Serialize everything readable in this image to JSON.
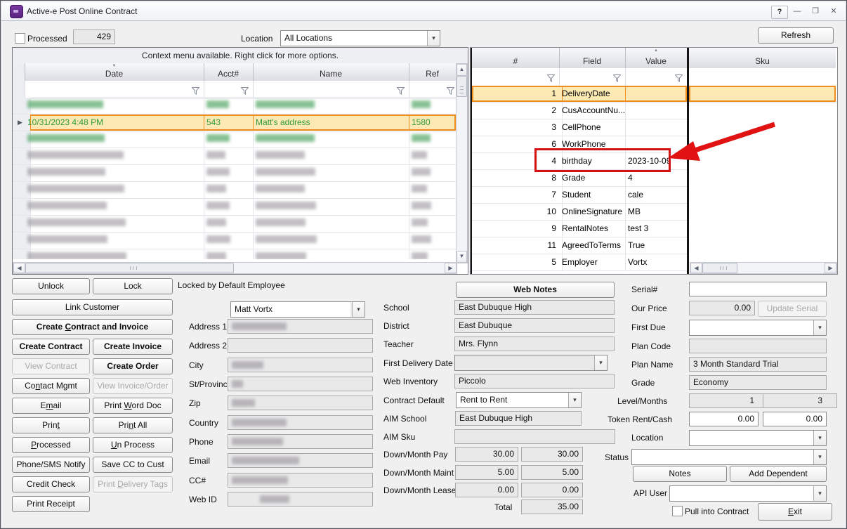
{
  "window": {
    "title": "Active-e Post Online Contract",
    "help_label": "?"
  },
  "toolbar": {
    "processed_label": "Processed",
    "processed_count": "429",
    "location_label": "Location",
    "location_value": "All Locations",
    "refresh_label": "Refresh"
  },
  "left_grid": {
    "caption": "Context menu available. Right click for more options.",
    "columns": [
      "Date",
      "Acct#",
      "Name",
      "Ref"
    ],
    "sort_column": "Date",
    "rows": [
      {
        "redacted": true,
        "tone": "green"
      },
      {
        "selected": true,
        "cells": [
          "10/31/2023 4:48 PM",
          "543",
          "Matt's address",
          "1580"
        ]
      },
      {
        "redacted": true,
        "tone": "green"
      },
      {
        "redacted": true,
        "tone": "gray"
      },
      {
        "redacted": true,
        "tone": "gray"
      },
      {
        "redacted": true,
        "tone": "gray"
      },
      {
        "redacted": true,
        "tone": "gray"
      },
      {
        "redacted": true,
        "tone": "gray"
      },
      {
        "redacted": true,
        "tone": "gray"
      },
      {
        "redacted": true,
        "tone": "gray"
      }
    ]
  },
  "right_grid": {
    "columns": [
      "#",
      "Field",
      "Value",
      "Sku"
    ],
    "sort_column": "Value",
    "rows": [
      {
        "num": "1",
        "field": "DeliveryDate",
        "value": "",
        "selected": true
      },
      {
        "num": "2",
        "field": "CusAccountNu...",
        "value": ""
      },
      {
        "num": "3",
        "field": "CellPhone",
        "value": ""
      },
      {
        "num": "6",
        "field": "WorkPhone",
        "value": ""
      },
      {
        "num": "4",
        "field": "birthday",
        "value": "2023-10-09",
        "annotated": true
      },
      {
        "num": "8",
        "field": "Grade",
        "value": "4"
      },
      {
        "num": "7",
        "field": "Student",
        "value": "cale"
      },
      {
        "num": "10",
        "field": "OnlineSignature",
        "value": "MB"
      },
      {
        "num": "9",
        "field": "RentalNotes",
        "value": "test 3"
      },
      {
        "num": "11",
        "field": "AgreedToTerms",
        "value": "True"
      },
      {
        "num": "5",
        "field": "Employer",
        "value": "Vortx"
      }
    ]
  },
  "annotation": {
    "target": "birthday row",
    "color": "#d51010"
  },
  "actions": {
    "unlock": {
      "label": "Unlock"
    },
    "lock": {
      "label": "Lock"
    },
    "locked_by": "Locked by Default Employee",
    "link_customer": {
      "label": "Link Customer"
    },
    "create_contract_invoice": {
      "label": "Create Contract and Invoice",
      "accel": 7
    },
    "create_contract": {
      "label": "Create Contract"
    },
    "create_invoice": {
      "label": "Create Invoice"
    },
    "view_contract": {
      "label": "View Contract"
    },
    "create_order": {
      "label": "Create Order"
    },
    "contact_mgmt": {
      "label": "Contact Mgmt",
      "accel": 2
    },
    "view_invoice_order": {
      "label": "View Invoice/Order"
    },
    "email": {
      "label": "Email",
      "accel": 1
    },
    "print_word_doc": {
      "label": "Print Word Doc",
      "accel": 6
    },
    "print": {
      "label": "Print",
      "accel": 4
    },
    "print_all": {
      "label": "Print All",
      "accel": 3
    },
    "processed": {
      "label": "Processed",
      "accel": 0
    },
    "un_process": {
      "label": "Un Process",
      "accel": 0
    },
    "phone_sms": {
      "label": "Phone/SMS Notify"
    },
    "save_cc": {
      "label": "Save CC to Cust"
    },
    "credit_check": {
      "label": "Credit Check"
    },
    "print_delivery_tags": {
      "label": "Print Delivery Tags",
      "accel": 6
    },
    "print_receipt": {
      "label": "Print Receipt"
    }
  },
  "customer": {
    "name_value": "Matt Vortx",
    "labels": {
      "address1": "Address 1",
      "address2": "Address 2",
      "city": "City",
      "state": "St/Province",
      "zip": "Zip",
      "country": "Country",
      "phone": "Phone",
      "email": "Email",
      "cc": "CC#",
      "webid": "Web ID"
    }
  },
  "details": {
    "web_notes_label": "Web Notes",
    "school_label": "School",
    "school": "East Dubuque High",
    "district_label": "District",
    "district": "East Dubuque",
    "teacher_label": "Teacher",
    "teacher": "Mrs. Flynn",
    "first_delivery_label": "First Delivery Date",
    "first_delivery": "",
    "web_inventory_label": "Web Inventory",
    "web_inventory": "Piccolo",
    "contract_default_label": "Contract Default",
    "contract_default": "Rent to Rent",
    "aim_school_label": "AIM School",
    "aim_school": "East Dubuque High",
    "aim_sku_label": "AIM Sku",
    "aim_sku": "",
    "down_pay_label": "Down/Month Pay",
    "down_pay": [
      "30.00",
      "30.00"
    ],
    "down_maint_label": "Down/Month Maint",
    "down_maint": [
      "5.00",
      "5.00"
    ],
    "down_lease_label": "Down/Month Lease",
    "down_lease": [
      "0.00",
      "0.00"
    ],
    "total_label": "Total",
    "total": "35.00"
  },
  "plan": {
    "serial_label": "Serial#",
    "serial": "",
    "our_price_label": "Our Price",
    "our_price": "0.00",
    "update_serial_label": "Update Serial",
    "first_due_label": "First Due",
    "first_due": "",
    "plan_code_label": "Plan Code",
    "plan_code": "",
    "plan_name_label": "Plan Name",
    "plan_name": "3 Month Standard Trial",
    "grade_label": "Grade",
    "grade": "Economy",
    "level_months_label": "Level/Months",
    "level": "1",
    "months": "3",
    "token_label": "Token Rent/Cash",
    "token_rent": "0.00",
    "token_cash": "0.00",
    "location_label": "Location",
    "location": "",
    "status_label": "Status",
    "status": "",
    "notes_label": "Notes",
    "add_dependent_label": "Add Dependent",
    "api_user_label": "API User",
    "api_user": "",
    "pull_label": "Pull into Contract",
    "exit": {
      "label": "Exit",
      "accel": 0
    }
  }
}
